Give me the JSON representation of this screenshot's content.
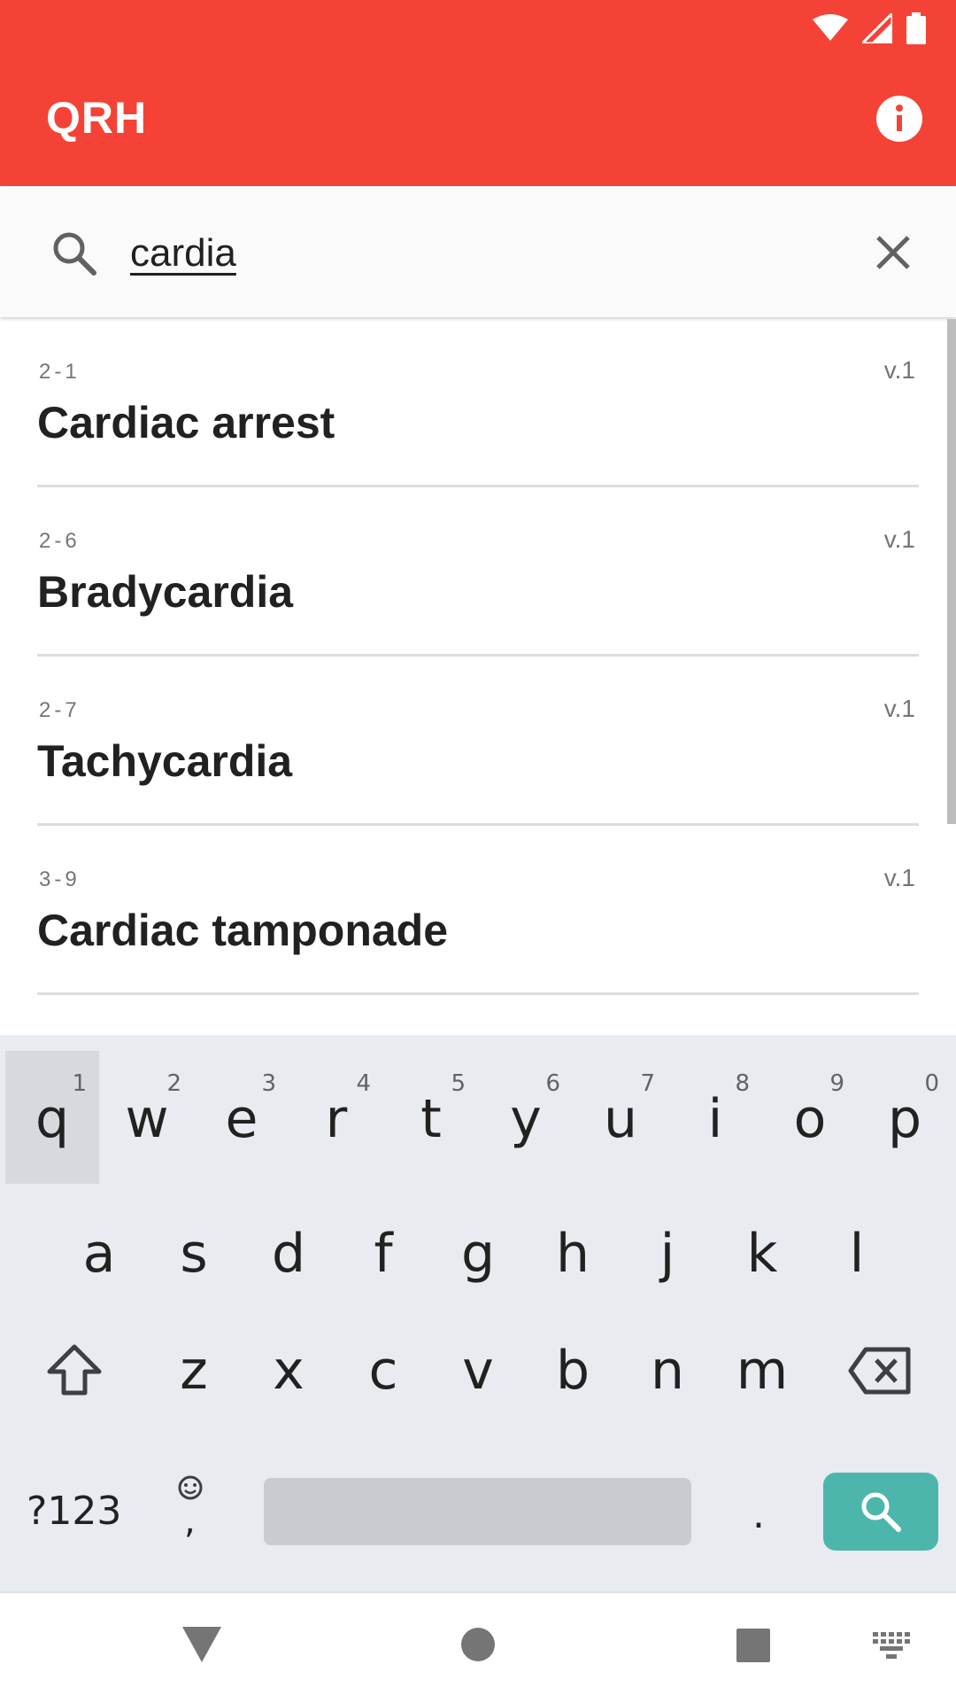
{
  "app_bar": {
    "title": "QRH",
    "color": "#f44336",
    "status_icons": [
      "wifi-icon",
      "signal-icon",
      "battery-icon"
    ],
    "info_icon": "info-icon"
  },
  "search": {
    "value": "cardia",
    "search_icon": "search-icon",
    "clear_icon": "close-icon"
  },
  "results": [
    {
      "code": "2-1",
      "version": "v.1",
      "title": "Cardiac arrest"
    },
    {
      "code": "2-6",
      "version": "v.1",
      "title": "Bradycardia"
    },
    {
      "code": "2-7",
      "version": "v.1",
      "title": "Tachycardia"
    },
    {
      "code": "3-9",
      "version": "v.1",
      "title": "Cardiac tamponade"
    }
  ],
  "keyboard": {
    "row1": [
      {
        "key": "q",
        "hint": "1"
      },
      {
        "key": "w",
        "hint": "2"
      },
      {
        "key": "e",
        "hint": "3"
      },
      {
        "key": "r",
        "hint": "4"
      },
      {
        "key": "t",
        "hint": "5"
      },
      {
        "key": "y",
        "hint": "6"
      },
      {
        "key": "u",
        "hint": "7"
      },
      {
        "key": "i",
        "hint": "8"
      },
      {
        "key": "o",
        "hint": "9"
      },
      {
        "key": "p",
        "hint": "0"
      }
    ],
    "row2": [
      "a",
      "s",
      "d",
      "f",
      "g",
      "h",
      "j",
      "k",
      "l"
    ],
    "row3": [
      "z",
      "x",
      "c",
      "v",
      "b",
      "n",
      "m"
    ],
    "symbols_label": "?123",
    "comma_label": ",",
    "period_label": ".",
    "enter_color": "#4db6ac"
  },
  "nav_bar": {
    "icons": [
      "back-icon",
      "home-icon",
      "recents-icon",
      "keyboard-switch-icon"
    ]
  }
}
